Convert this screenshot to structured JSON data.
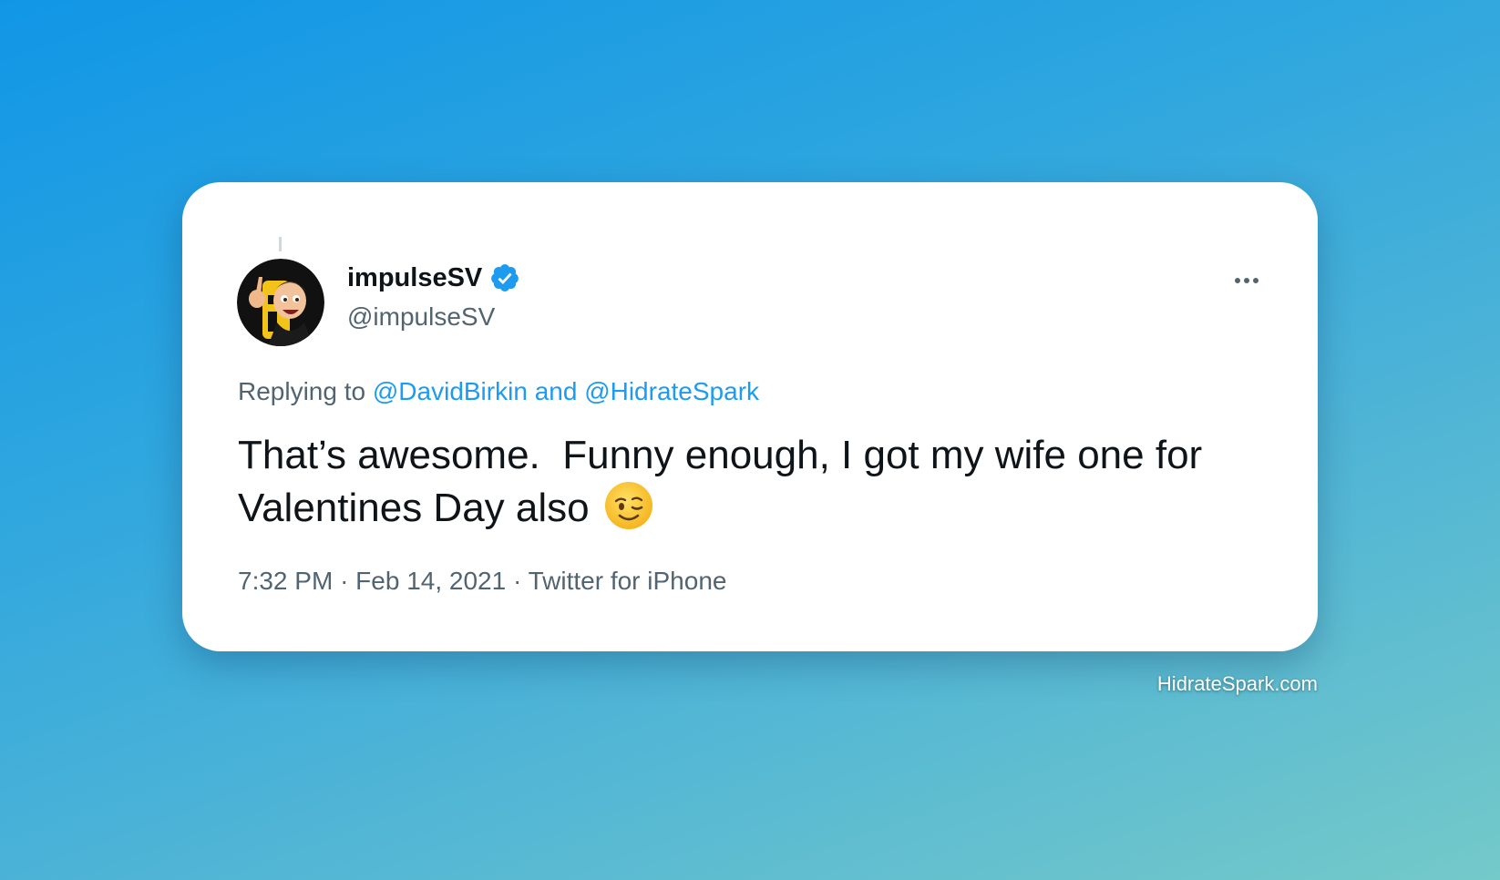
{
  "tweet": {
    "display_name": "impulseSV",
    "handle": "@impulseSV",
    "verified": true,
    "avatar": "cartoon-avatar-icon",
    "replying_prefix": "Replying to",
    "reply_mentions": [
      "@DavidBirkin",
      "@HidrateSpark"
    ],
    "reply_joiner": "and",
    "text": "That’s awesome.  Funny enough, I got my wife one for Valentines Day also",
    "emoji": "winking-face-icon",
    "time": "7:32 PM",
    "date": "Feb 14, 2021",
    "source": "Twitter for iPhone",
    "separator": "·",
    "more_menu": "more-icon"
  },
  "watermark": "HidrateSpark.com",
  "colors": {
    "accent": "#1d9bf0",
    "text": "#0f1419",
    "secondary": "#536471",
    "background_top": "#1196e6",
    "background_bottom": "#74c9c9"
  }
}
